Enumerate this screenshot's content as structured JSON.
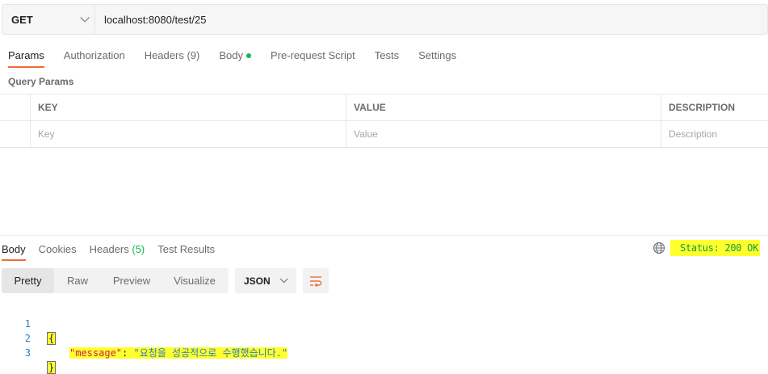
{
  "request": {
    "method": "GET",
    "url": "localhost:8080/test/25"
  },
  "request_tabs": [
    {
      "label": "Params",
      "active": true
    },
    {
      "label": "Authorization",
      "active": false
    },
    {
      "label": "Headers",
      "count": "(9)",
      "active": false
    },
    {
      "label": "Body",
      "indicator": "green-dot",
      "active": false
    },
    {
      "label": "Pre-request Script",
      "active": false
    },
    {
      "label": "Tests",
      "active": false
    },
    {
      "label": "Settings",
      "active": false
    }
  ],
  "query_params": {
    "title": "Query Params",
    "columns": [
      "KEY",
      "VALUE",
      "DESCRIPTION"
    ],
    "placeholders": [
      "Key",
      "Value",
      "Description"
    ]
  },
  "response_tabs": [
    {
      "label": "Body",
      "active": true
    },
    {
      "label": "Cookies",
      "active": false
    },
    {
      "label": "Headers",
      "count": "(5)",
      "active": false
    },
    {
      "label": "Test Results",
      "active": false
    }
  ],
  "response_status": {
    "icon": "globe-icon",
    "text": "Status: 200 OK",
    "highlight_color": "#ffff2e"
  },
  "view_modes": [
    "Pretty",
    "Raw",
    "Preview",
    "Visualize"
  ],
  "active_view_mode": "Pretty",
  "format": "JSON",
  "code_lines": [
    {
      "n": "1",
      "text": "{"
    },
    {
      "n": "2",
      "key": "\"message\"",
      "sep": ": ",
      "value": "\"요청을 성공적으로 수행했습니다.\""
    },
    {
      "n": "3",
      "text": "}"
    }
  ],
  "colors": {
    "accent": "#f26b3a",
    "success": "#0cbb52",
    "highlight": "#ffff2e"
  }
}
